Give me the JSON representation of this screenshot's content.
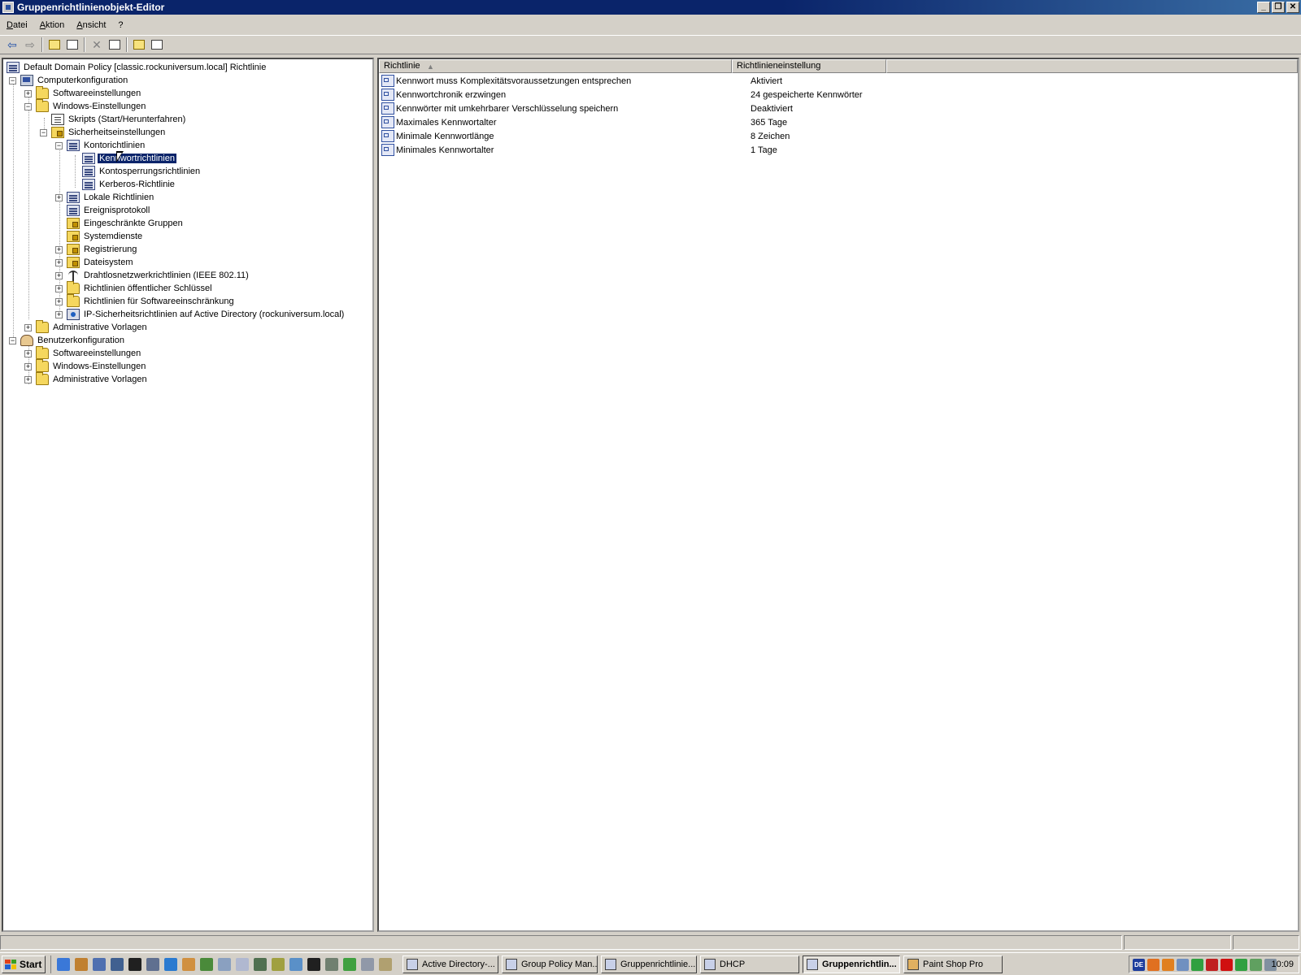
{
  "window": {
    "title": "Gruppenrichtlinienobjekt-Editor",
    "buttons": {
      "minimize": "_",
      "restore": "❐",
      "close": "✕"
    }
  },
  "menu": [
    "Datei",
    "Aktion",
    "Ansicht",
    "?"
  ],
  "toolbar": [
    "back-icon",
    "forward-icon",
    "up-folder-icon",
    "show-hide-tree-icon",
    "delete-icon",
    "properties-icon",
    "help-icon",
    "details-view-icon"
  ],
  "tree": {
    "root": "Default Domain Policy [classic.rockuniversum.local] Richtlinie",
    "computer": "Computerkonfiguration",
    "c_software": "Softwareeinstellungen",
    "c_windows": "Windows-Einstellungen",
    "c_scripts": "Skripts (Start/Herunterfahren)",
    "c_security": "Sicherheitseinstellungen",
    "c_account": "Kontorichtlinien",
    "c_password": "Kennwortrichtlinien",
    "c_lockout": "Kontosperrungsrichtlinien",
    "c_kerberos": "Kerberos-Richtlinie",
    "c_local": "Lokale Richtlinien",
    "c_eventlog": "Ereignisprotokoll",
    "c_restricted": "Eingeschränkte Gruppen",
    "c_services": "Systemdienste",
    "c_registry": "Registrierung",
    "c_filesystem": "Dateisystem",
    "c_wireless": "Drahtlosnetzwerkrichtlinien (IEEE 802.11)",
    "c_publickey": "Richtlinien öffentlicher Schlüssel",
    "c_softrestrict": "Richtlinien für Softwareeinschränkung",
    "c_ipsec": "IP-Sicherheitsrichtlinien auf Active Directory (rockuniversum.local)",
    "c_admin": "Administrative Vorlagen",
    "user": "Benutzerkonfiguration",
    "u_software": "Softwareeinstellungen",
    "u_windows": "Windows-Einstellungen",
    "u_admin": "Administrative Vorlagen"
  },
  "list": {
    "columns": [
      "Richtlinie",
      "Richtlinieneinstellung"
    ],
    "sort_indicator": "▲",
    "rows": [
      {
        "policy": "Kennwort muss Komplexitätsvoraussetzungen entsprechen",
        "setting": "Aktiviert"
      },
      {
        "policy": "Kennwortchronik erzwingen",
        "setting": "24 gespeicherte Kennwörter"
      },
      {
        "policy": "Kennwörter mit umkehrbarer Verschlüsselung speichern",
        "setting": "Deaktiviert"
      },
      {
        "policy": "Maximales Kennwortalter",
        "setting": "365 Tage"
      },
      {
        "policy": "Minimale Kennwortlänge",
        "setting": "8 Zeichen"
      },
      {
        "policy": "Minimales Kennwortalter",
        "setting": "1 Tage"
      }
    ]
  },
  "taskbar": {
    "start": "Start",
    "tasks": [
      "Active Directory-...",
      "Group Policy Man...",
      "Gruppenrichtlinie...",
      "DHCP",
      "Gruppenrichtlin...",
      "Paint Shop Pro"
    ],
    "language": "DE",
    "clock": "10:09"
  },
  "colors": {
    "titlebar": "#0a246a",
    "selection": "#0a246a",
    "face": "#d4d0c8"
  }
}
